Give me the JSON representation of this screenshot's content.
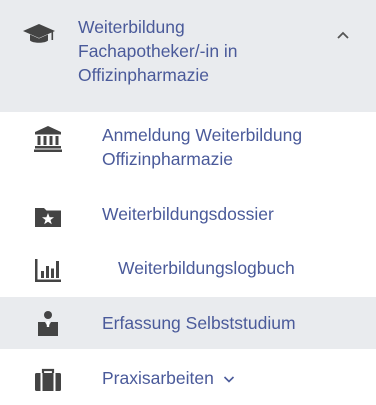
{
  "menu": {
    "parent": {
      "label_lines": [
        "Weiterbildung",
        "Fachapotheker/-in in",
        "Offizinpharmazie"
      ],
      "icon": "graduation-cap-icon",
      "expanded": true
    },
    "items": [
      {
        "label_lines": [
          "Anmeldung Weiterbildung",
          "Offizinpharmazie"
        ],
        "icon": "institution-icon"
      },
      {
        "label": "Weiterbildungsdossier",
        "icon": "star-folder-icon"
      },
      {
        "label": "Weiterbildungslogbuch",
        "icon": "bar-chart-icon"
      },
      {
        "label": "Erfassung Selbststudium",
        "icon": "person-desk-icon",
        "active": true
      },
      {
        "label": "Praxisarbeiten",
        "icon": "briefcase-icon",
        "has_submenu": true
      }
    ]
  },
  "colors": {
    "text": "#4a5a9a",
    "icon": "#444444",
    "active_background": "#e9ebee"
  }
}
